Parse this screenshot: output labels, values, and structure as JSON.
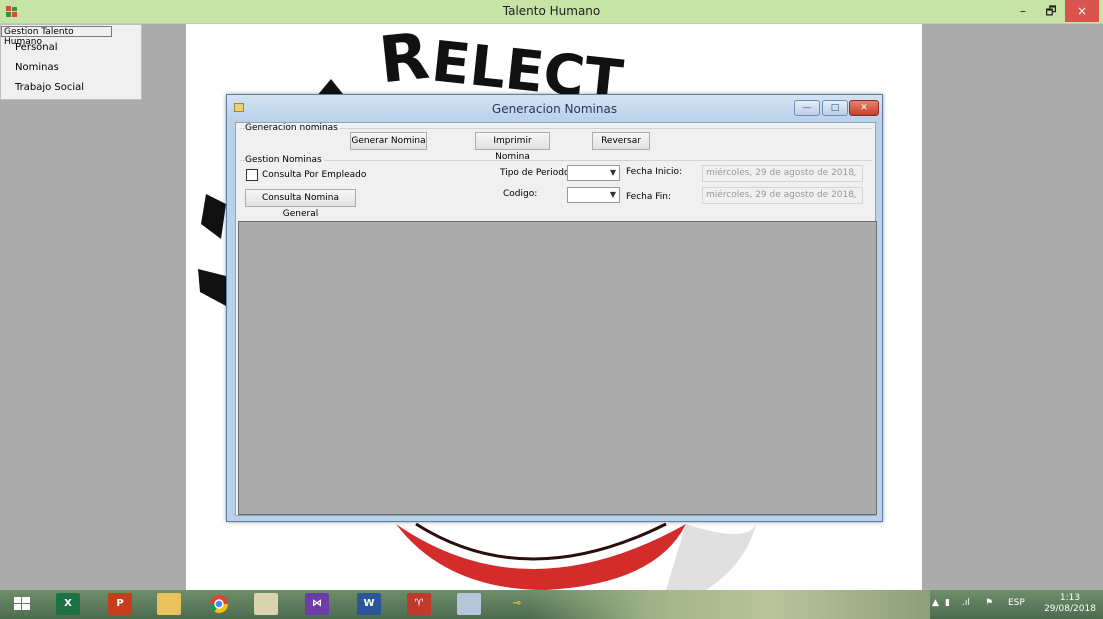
{
  "app": {
    "title": "Talento Humano",
    "window_controls": {
      "minimize": "–",
      "maximize": "🗗",
      "close": "×"
    }
  },
  "menu": {
    "header": "Gestion Talento Humano",
    "items": [
      {
        "label": "Personal"
      },
      {
        "label": "Nominas"
      },
      {
        "label": "Trabajo Social"
      }
    ]
  },
  "child_window": {
    "title": "Generacion Nominas",
    "controls": {
      "minimize": "—",
      "maximize": "□",
      "close": "✕"
    },
    "group_generacion": {
      "title": "Generacion nominas",
      "buttons": {
        "generar": "Generar Nomina",
        "imprimir": "Imprimir Nomina",
        "reversar": "Reversar"
      }
    },
    "group_gestion": {
      "title": "Gestion Nominas",
      "checkbox_label": "Consulta Por Empleado",
      "checkbox_checked": false,
      "consulta_general_button": "Consulta Nomina General",
      "tipo_periodo_label": "Tipo de Periodo:",
      "tipo_periodo_value": "",
      "codigo_label": "Codigo:",
      "codigo_value": "",
      "fecha_inicio_label": "Fecha Inicio:",
      "fecha_inicio_value": "miércoles, 29 de   agosto   de 2018",
      "fecha_fin_label": "Fecha Fin:",
      "fecha_fin_value": "miércoles, 29 de   agosto   de 2018"
    }
  },
  "background_logo_text": "ELECT",
  "taskbar": {
    "apps": [
      {
        "name": "windows-start-icon",
        "label": ""
      },
      {
        "name": "excel-icon",
        "label": "X"
      },
      {
        "name": "powerpoint-icon",
        "label": "P"
      },
      {
        "name": "file-explorer-icon",
        "label": ""
      },
      {
        "name": "chrome-icon",
        "label": ""
      },
      {
        "name": "setup-tool-icon",
        "label": ""
      },
      {
        "name": "visual-studio-icon",
        "label": ""
      },
      {
        "name": "word-icon",
        "label": "W"
      },
      {
        "name": "acrobat-icon",
        "label": ""
      },
      {
        "name": "snipping-tool-icon",
        "label": ""
      },
      {
        "name": "key-app-icon",
        "label": ""
      }
    ],
    "tray_language": "ESP",
    "clock_time": "1:13",
    "clock_date": "29/08/2018"
  },
  "colors": {
    "titlebar_green": "#c7e3a5",
    "close_red": "#d9534f",
    "logo_red": "#d42b2b",
    "mdi_gray": "#ababab"
  }
}
